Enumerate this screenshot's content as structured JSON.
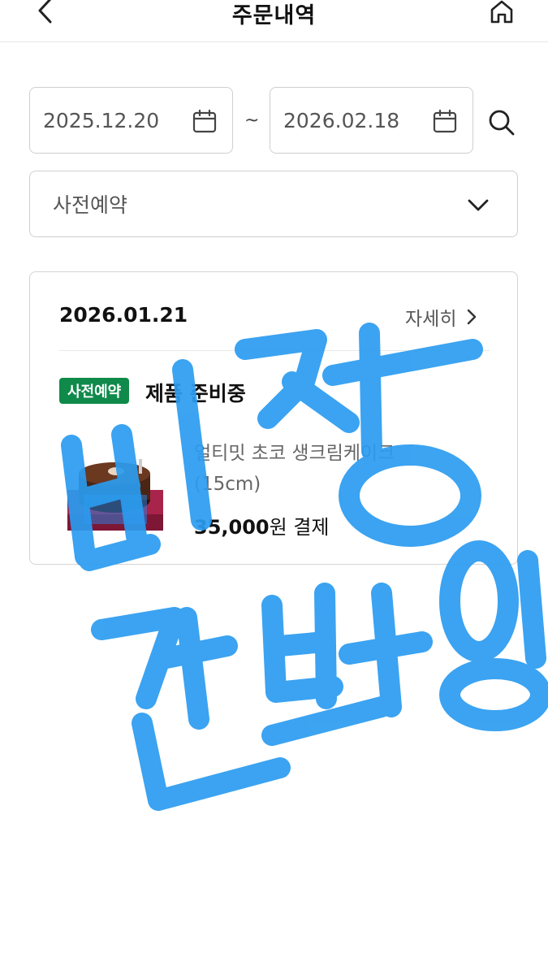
{
  "header": {
    "title": "주문내역",
    "back_icon": "chevron-left-icon",
    "home_icon": "home-icon"
  },
  "filters": {
    "start_date": "2025.12.20",
    "end_date": "2026.02.18",
    "separator": "~",
    "calendar_icon": "calendar-icon",
    "search_icon": "search-icon",
    "order_type": "사전예약",
    "dropdown_icon": "chevron-down-icon"
  },
  "order": {
    "date": "2026.01.21",
    "detail_label": "자세히",
    "badge": "사전예약",
    "status": "제품 준비중",
    "product_name": "얼티밋 초코 생크림케이크 (15cm)",
    "price": "35,000",
    "price_suffix": "원 결제",
    "badge_color": "#0f8a4a"
  },
  "watermark": {
    "text": "비상 건방앙",
    "color": "#2b9cf0"
  }
}
